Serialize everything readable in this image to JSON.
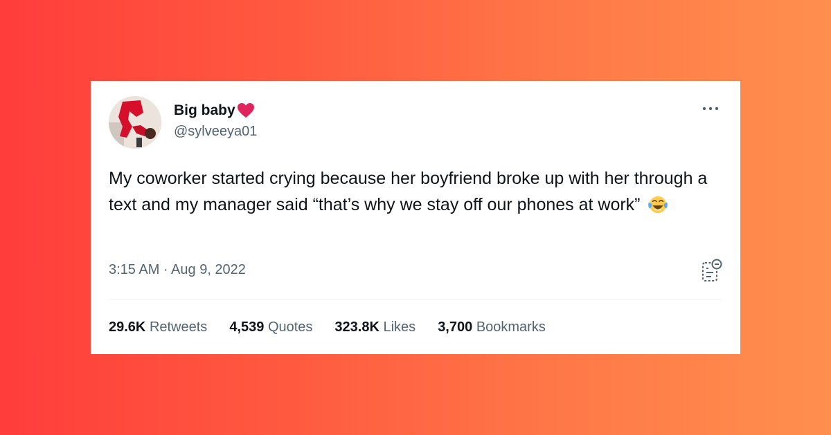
{
  "tweet": {
    "author": {
      "display_name": "Big baby",
      "handle": "@sylveeya01"
    },
    "text": "My coworker started crying because her boyfriend broke up with her through a text and my manager said “that’s why we stay off our phones at work”",
    "timestamp": "3:15 AM · Aug 9, 2022",
    "stats": [
      {
        "count": "29.6K",
        "label": "Retweets"
      },
      {
        "count": "4,539",
        "label": "Quotes"
      },
      {
        "count": "323.8K",
        "label": "Likes"
      },
      {
        "count": "3,700",
        "label": "Bookmarks"
      }
    ]
  },
  "icons": {
    "name_emoji": "heart-icon",
    "text_emoji": "face-with-tears-of-joy-icon",
    "menu": "more-icon",
    "notes": "community-notes-icon"
  },
  "colors": {
    "background_start": "#ff3d3b",
    "background_end": "#ff8f4e",
    "card": "#ffffff",
    "text_primary": "#0f1419",
    "text_secondary": "#536471",
    "heart": "#e0245e"
  }
}
